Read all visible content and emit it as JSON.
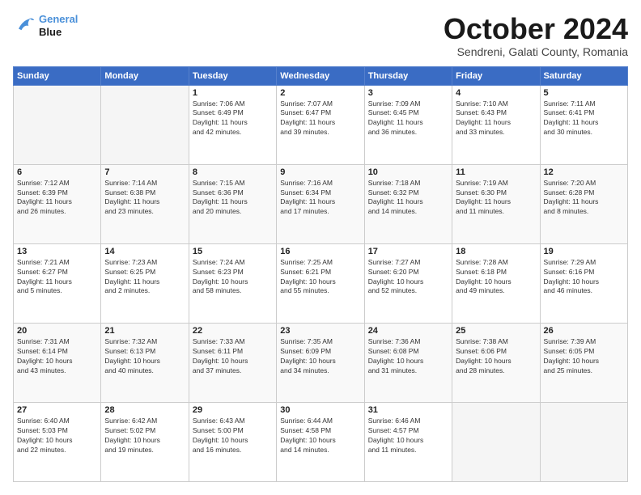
{
  "header": {
    "logo": {
      "line1": "General",
      "line2": "Blue"
    },
    "title": "October 2024",
    "location": "Sendreni, Galati County, Romania"
  },
  "weekdays": [
    "Sunday",
    "Monday",
    "Tuesday",
    "Wednesday",
    "Thursday",
    "Friday",
    "Saturday"
  ],
  "weeks": [
    [
      {
        "day": "",
        "info": ""
      },
      {
        "day": "",
        "info": ""
      },
      {
        "day": "1",
        "info": "Sunrise: 7:06 AM\nSunset: 6:49 PM\nDaylight: 11 hours\nand 42 minutes."
      },
      {
        "day": "2",
        "info": "Sunrise: 7:07 AM\nSunset: 6:47 PM\nDaylight: 11 hours\nand 39 minutes."
      },
      {
        "day": "3",
        "info": "Sunrise: 7:09 AM\nSunset: 6:45 PM\nDaylight: 11 hours\nand 36 minutes."
      },
      {
        "day": "4",
        "info": "Sunrise: 7:10 AM\nSunset: 6:43 PM\nDaylight: 11 hours\nand 33 minutes."
      },
      {
        "day": "5",
        "info": "Sunrise: 7:11 AM\nSunset: 6:41 PM\nDaylight: 11 hours\nand 30 minutes."
      }
    ],
    [
      {
        "day": "6",
        "info": "Sunrise: 7:12 AM\nSunset: 6:39 PM\nDaylight: 11 hours\nand 26 minutes."
      },
      {
        "day": "7",
        "info": "Sunrise: 7:14 AM\nSunset: 6:38 PM\nDaylight: 11 hours\nand 23 minutes."
      },
      {
        "day": "8",
        "info": "Sunrise: 7:15 AM\nSunset: 6:36 PM\nDaylight: 11 hours\nand 20 minutes."
      },
      {
        "day": "9",
        "info": "Sunrise: 7:16 AM\nSunset: 6:34 PM\nDaylight: 11 hours\nand 17 minutes."
      },
      {
        "day": "10",
        "info": "Sunrise: 7:18 AM\nSunset: 6:32 PM\nDaylight: 11 hours\nand 14 minutes."
      },
      {
        "day": "11",
        "info": "Sunrise: 7:19 AM\nSunset: 6:30 PM\nDaylight: 11 hours\nand 11 minutes."
      },
      {
        "day": "12",
        "info": "Sunrise: 7:20 AM\nSunset: 6:28 PM\nDaylight: 11 hours\nand 8 minutes."
      }
    ],
    [
      {
        "day": "13",
        "info": "Sunrise: 7:21 AM\nSunset: 6:27 PM\nDaylight: 11 hours\nand 5 minutes."
      },
      {
        "day": "14",
        "info": "Sunrise: 7:23 AM\nSunset: 6:25 PM\nDaylight: 11 hours\nand 2 minutes."
      },
      {
        "day": "15",
        "info": "Sunrise: 7:24 AM\nSunset: 6:23 PM\nDaylight: 10 hours\nand 58 minutes."
      },
      {
        "day": "16",
        "info": "Sunrise: 7:25 AM\nSunset: 6:21 PM\nDaylight: 10 hours\nand 55 minutes."
      },
      {
        "day": "17",
        "info": "Sunrise: 7:27 AM\nSunset: 6:20 PM\nDaylight: 10 hours\nand 52 minutes."
      },
      {
        "day": "18",
        "info": "Sunrise: 7:28 AM\nSunset: 6:18 PM\nDaylight: 10 hours\nand 49 minutes."
      },
      {
        "day": "19",
        "info": "Sunrise: 7:29 AM\nSunset: 6:16 PM\nDaylight: 10 hours\nand 46 minutes."
      }
    ],
    [
      {
        "day": "20",
        "info": "Sunrise: 7:31 AM\nSunset: 6:14 PM\nDaylight: 10 hours\nand 43 minutes."
      },
      {
        "day": "21",
        "info": "Sunrise: 7:32 AM\nSunset: 6:13 PM\nDaylight: 10 hours\nand 40 minutes."
      },
      {
        "day": "22",
        "info": "Sunrise: 7:33 AM\nSunset: 6:11 PM\nDaylight: 10 hours\nand 37 minutes."
      },
      {
        "day": "23",
        "info": "Sunrise: 7:35 AM\nSunset: 6:09 PM\nDaylight: 10 hours\nand 34 minutes."
      },
      {
        "day": "24",
        "info": "Sunrise: 7:36 AM\nSunset: 6:08 PM\nDaylight: 10 hours\nand 31 minutes."
      },
      {
        "day": "25",
        "info": "Sunrise: 7:38 AM\nSunset: 6:06 PM\nDaylight: 10 hours\nand 28 minutes."
      },
      {
        "day": "26",
        "info": "Sunrise: 7:39 AM\nSunset: 6:05 PM\nDaylight: 10 hours\nand 25 minutes."
      }
    ],
    [
      {
        "day": "27",
        "info": "Sunrise: 6:40 AM\nSunset: 5:03 PM\nDaylight: 10 hours\nand 22 minutes."
      },
      {
        "day": "28",
        "info": "Sunrise: 6:42 AM\nSunset: 5:02 PM\nDaylight: 10 hours\nand 19 minutes."
      },
      {
        "day": "29",
        "info": "Sunrise: 6:43 AM\nSunset: 5:00 PM\nDaylight: 10 hours\nand 16 minutes."
      },
      {
        "day": "30",
        "info": "Sunrise: 6:44 AM\nSunset: 4:58 PM\nDaylight: 10 hours\nand 14 minutes."
      },
      {
        "day": "31",
        "info": "Sunrise: 6:46 AM\nSunset: 4:57 PM\nDaylight: 10 hours\nand 11 minutes."
      },
      {
        "day": "",
        "info": ""
      },
      {
        "day": "",
        "info": ""
      }
    ]
  ]
}
